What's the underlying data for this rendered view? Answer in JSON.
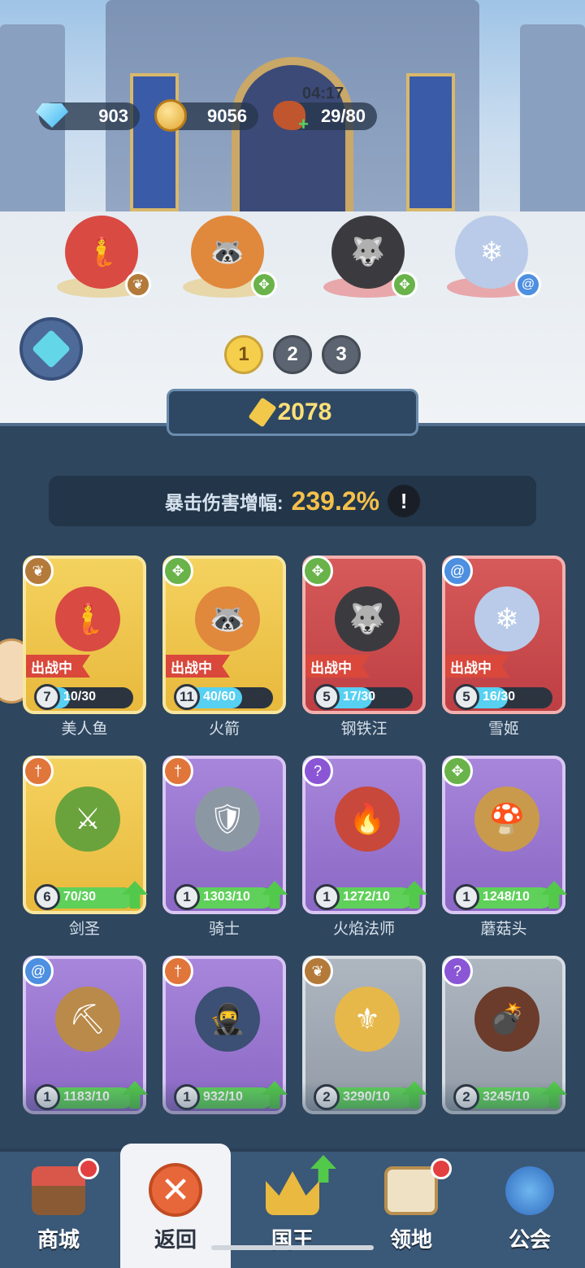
{
  "resources": {
    "gems": "903",
    "coins": "9056",
    "stamina": "29/80",
    "stamina_timer": "04:17"
  },
  "team": [
    {
      "icon": "mermaid-hero",
      "cls_icon": "wing-icon"
    },
    {
      "icon": "rocket-hero",
      "cls_icon": "crosshair-icon"
    },
    {
      "icon": "steel-dog-hero",
      "cls_icon": "crosshair-icon"
    },
    {
      "icon": "snow-princess-hero",
      "cls_icon": "swirl-icon"
    }
  ],
  "pages": [
    "1",
    "2",
    "3"
  ],
  "active_page": "1",
  "power": "2078",
  "crit": {
    "label": "暴击伤害增幅:",
    "value": "239.2%",
    "info": "!"
  },
  "deploy_label": "出战中",
  "heroes": [
    {
      "name": "美人鱼",
      "level": "7",
      "progress": "10/30",
      "fill": 0.33,
      "deployed": true,
      "rarity": "gold",
      "cls": "wing"
    },
    {
      "name": "火箭",
      "level": "11",
      "progress": "40/60",
      "fill": 0.67,
      "deployed": true,
      "rarity": "gold",
      "cls": "crosshair"
    },
    {
      "name": "钢铁汪",
      "level": "5",
      "progress": "17/30",
      "fill": 0.57,
      "deployed": true,
      "rarity": "red",
      "cls": "crosshair"
    },
    {
      "name": "雪姬",
      "level": "5",
      "progress": "16/30",
      "fill": 0.53,
      "deployed": true,
      "rarity": "red",
      "cls": "swirl"
    },
    {
      "name": "剑圣",
      "level": "6",
      "progress": "70/30",
      "fill": 1,
      "deployed": false,
      "rarity": "gold",
      "cls": "sword",
      "upgrade": true
    },
    {
      "name": "骑士",
      "level": "1",
      "progress": "1303/10",
      "fill": 1,
      "deployed": false,
      "rarity": "purple",
      "cls": "sword",
      "upgrade": true
    },
    {
      "name": "火焰法师",
      "level": "1",
      "progress": "1272/10",
      "fill": 1,
      "deployed": false,
      "rarity": "purple",
      "cls": "staff",
      "upgrade": true
    },
    {
      "name": "蘑菇头",
      "level": "1",
      "progress": "1248/10",
      "fill": 1,
      "deployed": false,
      "rarity": "purple",
      "cls": "crosshair",
      "upgrade": true
    },
    {
      "name": "",
      "level": "1",
      "progress": "1183/10",
      "fill": 1,
      "deployed": false,
      "rarity": "purple",
      "cls": "swirl",
      "upgrade": true
    },
    {
      "name": "",
      "level": "1",
      "progress": "932/10",
      "fill": 1,
      "deployed": false,
      "rarity": "purple",
      "cls": "sword",
      "upgrade": true
    },
    {
      "name": "",
      "level": "2",
      "progress": "3290/10",
      "fill": 1,
      "deployed": false,
      "rarity": "gray",
      "cls": "wing",
      "upgrade": true
    },
    {
      "name": "",
      "level": "2",
      "progress": "3245/10",
      "fill": 1,
      "deployed": false,
      "rarity": "gray",
      "cls": "staff",
      "upgrade": true
    }
  ],
  "nav": [
    {
      "label": "商城",
      "icon": "shop-icon",
      "dot": true
    },
    {
      "label": "返回",
      "icon": "close-icon",
      "active": true
    },
    {
      "label": "国王",
      "icon": "crown-icon",
      "upgrade": true
    },
    {
      "label": "领地",
      "icon": "castle-icon",
      "dot": true
    },
    {
      "label": "公会",
      "icon": "planet-icon"
    }
  ],
  "colors": {
    "gold": "#f4d25f",
    "red": "#d75a5a",
    "purple": "#a786db",
    "gray": "#aeb6c0",
    "accent": "#f5c04a"
  }
}
